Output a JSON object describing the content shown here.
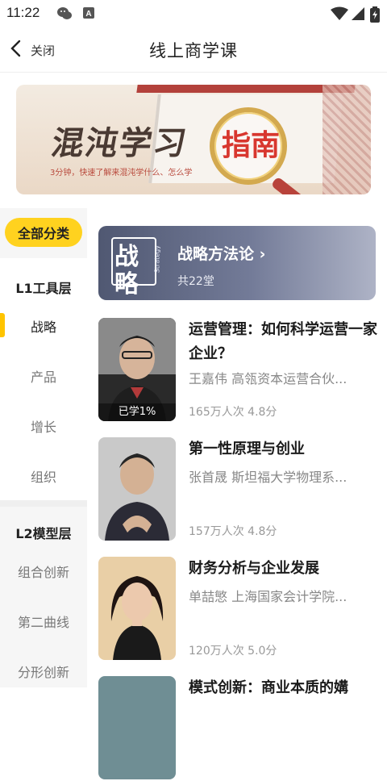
{
  "status_bar": {
    "time": "11:22",
    "icons": [
      "wechat-icon",
      "a-icon",
      "wifi-icon",
      "signal-icon",
      "battery-icon"
    ]
  },
  "header": {
    "back_label": "关闭",
    "title": "线上商学课"
  },
  "banner": {
    "title": "混沌学习",
    "title_highlight": "指南",
    "subtitle": "3分钟，快速了解来混沌学什么、怎么学"
  },
  "sidebar": {
    "all_label": "全部分类",
    "groups": [
      {
        "title": "L1工具层",
        "items": [
          "战略",
          "产品",
          "增长",
          "组织"
        ]
      },
      {
        "title": "L2模型层",
        "items": [
          "组合创新",
          "第二曲线",
          "分形创新"
        ]
      }
    ],
    "active_item": "战略"
  },
  "category_card": {
    "logo_char": "战略",
    "logo_sub": "Strategy",
    "title": "战略方法论 ›",
    "count": "共22堂"
  },
  "courses": [
    {
      "title": "运营管理：如何科学运营一家企业？",
      "author": "王嘉伟 高瓴资本运营合伙...",
      "meta": "165万人次 4.8分",
      "progress": "已学1%"
    },
    {
      "title": "第一性原理与创业",
      "author": "张首晟 斯坦福大学物理系...",
      "meta": "157万人次 4.8分"
    },
    {
      "title": "财务分析与企业发展",
      "author": "单喆慜 上海国家会计学院...",
      "meta": "120万人次 5.0分"
    },
    {
      "title": "模式创新：商业本质的媾"
    }
  ],
  "colors": {
    "accent": "#ffd21f",
    "active_bar": "#ffc400",
    "card_bg": "#5b627e"
  }
}
